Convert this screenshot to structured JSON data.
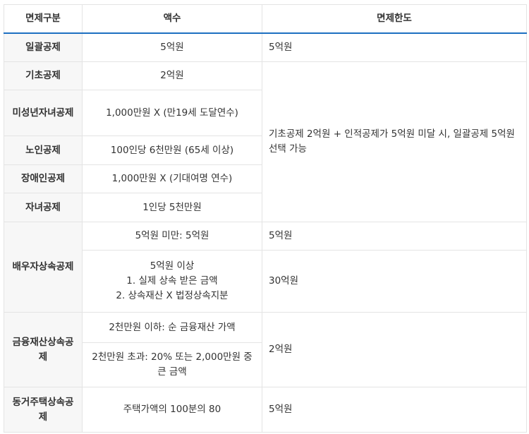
{
  "table": {
    "headers": [
      "면제구분",
      "액수",
      "면제한도"
    ],
    "rows": {
      "r1": {
        "category": "일괄공제",
        "amount": "5억원",
        "limit": "5억원"
      },
      "r2": {
        "category": "기초공제",
        "amount": "2억원"
      },
      "r3": {
        "category": "미성년자녀공제",
        "amount": "1,000만원 X (만19세 도달연수)"
      },
      "r4": {
        "category": "노인공제",
        "amount": "100인당 6천만원 (65세 이상)"
      },
      "r5": {
        "category": "장애인공제",
        "amount": "1,000만원 X (기대여명 연수)"
      },
      "r6": {
        "category": "자녀공제",
        "amount": "1인당 5천만원"
      },
      "shared_limit": "기초공제 2억원 + 인적공제가 5억원 미달 시, 일괄공제 5억원 선택 가능",
      "spouse": {
        "category": "배우자상속공제",
        "a_amount": "5억원 미만: 5억원",
        "a_limit": "5억원",
        "b_amount_line1": "5억원 이상",
        "b_amount_line2": "1. 실제 상속 받은 금액",
        "b_amount_line3": "2. 상속재산 X 법정상속지분",
        "b_limit": "30억원"
      },
      "financial": {
        "category": "금융재산상속공제",
        "a_amount": "2천만원 이하: 순 금융재산 가액",
        "b_amount": "2천만원 초과: 20% 또는 2,000만원 중 큰 금액",
        "limit": "2억원"
      },
      "housing": {
        "category": "동거주택상속공제",
        "amount": "주택가액의 100분의 80",
        "limit": "5억원"
      }
    }
  }
}
